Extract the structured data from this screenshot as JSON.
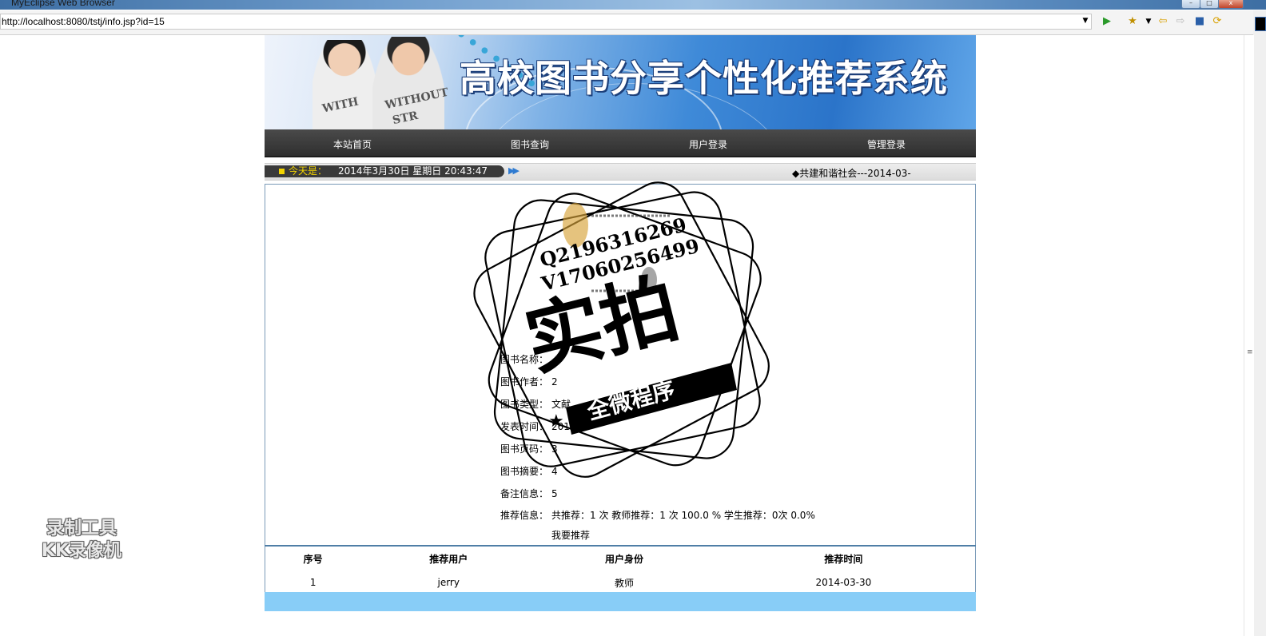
{
  "browser": {
    "window_title": "MyEclipse Web Browser",
    "url": "http://localhost:8080/tstj/info.jsp?id=15"
  },
  "site": {
    "title": "高校图书分享个性化推荐系统",
    "banner_shirt_text": [
      "WITH",
      "WITHOUT",
      "STR"
    ]
  },
  "nav": {
    "items": [
      {
        "label": "本站首页"
      },
      {
        "label": "图书查询"
      },
      {
        "label": "用户登录"
      },
      {
        "label": "管理登录"
      }
    ]
  },
  "datebar": {
    "label": "今天是：",
    "date": "2014年3月30日 星期日 20:43:47",
    "marquee": "◆共建和谐社会---2014-03-"
  },
  "book": {
    "fields": [
      {
        "label": "图书名称：",
        "value": ""
      },
      {
        "label": "图书作者：",
        "value": "2"
      },
      {
        "label": "图书类型：",
        "value": "文献"
      },
      {
        "label": "发表时间：",
        "value": "2013-"
      },
      {
        "label": "图书页码：",
        "value": "3"
      },
      {
        "label": "图书摘要：",
        "value": "4"
      },
      {
        "label": "备注信息：",
        "value": "5"
      },
      {
        "label": "推荐信息：",
        "value": "共推荐：1 次 教师推荐：1 次 100.0 % 学生推荐：0次 0.0%"
      }
    ],
    "recommend_link": "我要推荐"
  },
  "recommendations": {
    "headers": [
      "序号",
      "推荐用户",
      "用户身份",
      "推荐时间"
    ],
    "rows": [
      [
        "1",
        "jerry",
        "教师",
        "2014-03-30"
      ]
    ]
  },
  "overlays": {
    "recorder_watermark": [
      "录制工具",
      "KK录像机"
    ],
    "stamp": {
      "qq": "Q2196316269",
      "wechat": "V17060256499",
      "big_text": "实拍",
      "banner_text": "全微程序"
    }
  },
  "colors": {
    "nav_bg": "#333333",
    "footer_bg": "#88cdf7",
    "date_label": "#f3d400",
    "table_border": "#4f7ea6"
  }
}
